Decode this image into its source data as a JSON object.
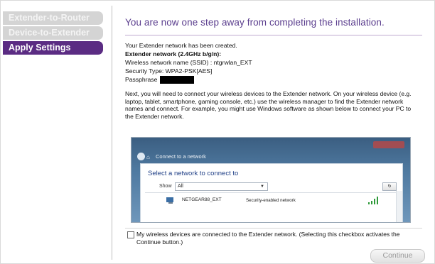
{
  "sidebar": {
    "steps": [
      {
        "label": "Extender-to-Router",
        "state": "completed"
      },
      {
        "label": "Device-to-Extender",
        "state": "completed"
      },
      {
        "label": "Apply Settings",
        "state": "active"
      }
    ]
  },
  "main": {
    "headline": "You are now one step away from completing the installation.",
    "created_line": "Your Extender network has been created.",
    "band_line": "Extender network (2.4GHz b/g/n):",
    "ssid_line": "Wireless network name (SSID) : ntgrwlan_EXT",
    "security_line": "Security Type: WPA2-PSK[AES]",
    "passphrase_label": "Passphrase",
    "instructions": "Next, you will need to connect your wireless devices to the Extender network. On your wireless device (e.g. laptop, tablet, smartphone, gaming console, etc.) use the wireless manager to find the Extender network names and connect. For example, you might use Windows software as shown below to connect your PC to the Extender network."
  },
  "windows_example": {
    "title": "Connect to a network",
    "heading": "Select a network to connect to",
    "show_label": "Show",
    "show_value": "All",
    "network": {
      "ssid": "NETGEAR88_EXT",
      "security": "Security-enabled network"
    }
  },
  "footer": {
    "checkbox_label": "My wireless devices are connected to the Extender network. (Selecting this checkbox activates the Continue button.)",
    "checkbox_checked": false,
    "continue_label": "Continue"
  },
  "colors": {
    "accent_purple": "#5b2c83",
    "headline_purple": "#5b3e8e",
    "completed_step_gray": "#d4d4d4"
  }
}
